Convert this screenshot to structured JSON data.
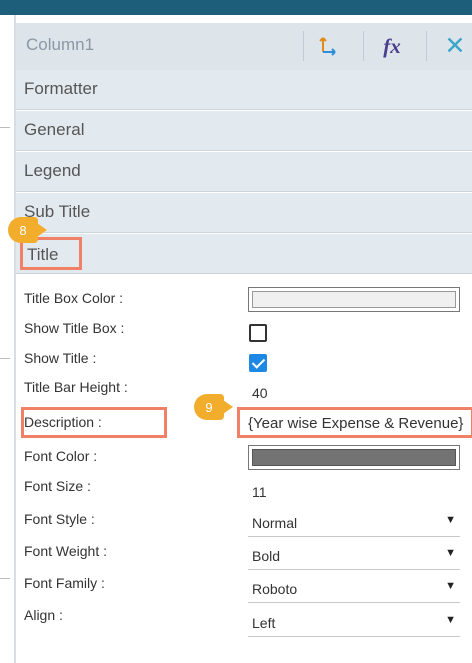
{
  "header": {
    "title": "Column1",
    "icons": [
      "axis-icon",
      "fx-icon",
      "close-icon"
    ],
    "fx_text": "fx",
    "close_text": "✕"
  },
  "accordion": [
    {
      "label": "Formatter"
    },
    {
      "label": "General"
    },
    {
      "label": "Legend"
    },
    {
      "label": "Sub Title"
    },
    {
      "label": "Title"
    }
  ],
  "properties": {
    "title_box_color": {
      "label": "Title Box Color :",
      "color": "#f0f0f0"
    },
    "show_title_box": {
      "label": "Show Title Box :",
      "checked": false
    },
    "show_title": {
      "label": "Show Title :",
      "checked": true
    },
    "title_bar_height": {
      "label": "Title Bar Height :",
      "value": "40"
    },
    "description": {
      "label": "Description :",
      "value": "{Year wise Expense & Revenue}"
    },
    "font_color": {
      "label": "Font Color :",
      "color": "#737373"
    },
    "font_size": {
      "label": "Font Size :",
      "value": "11"
    },
    "font_style": {
      "label": "Font Style :",
      "value": "Normal"
    },
    "font_weight": {
      "label": "Font Weight :",
      "value": "Bold"
    },
    "font_family": {
      "label": "Font Family :",
      "value": "Roboto"
    },
    "align": {
      "label": "Align :",
      "value": "Left"
    }
  },
  "badges": {
    "step8": "8",
    "step9": "9"
  },
  "colors": {
    "topbar": "#1d5f7a",
    "accent_highlight": "#f08066",
    "badge": "#f2ad2c",
    "checkbox_checked": "#1e88e5"
  }
}
